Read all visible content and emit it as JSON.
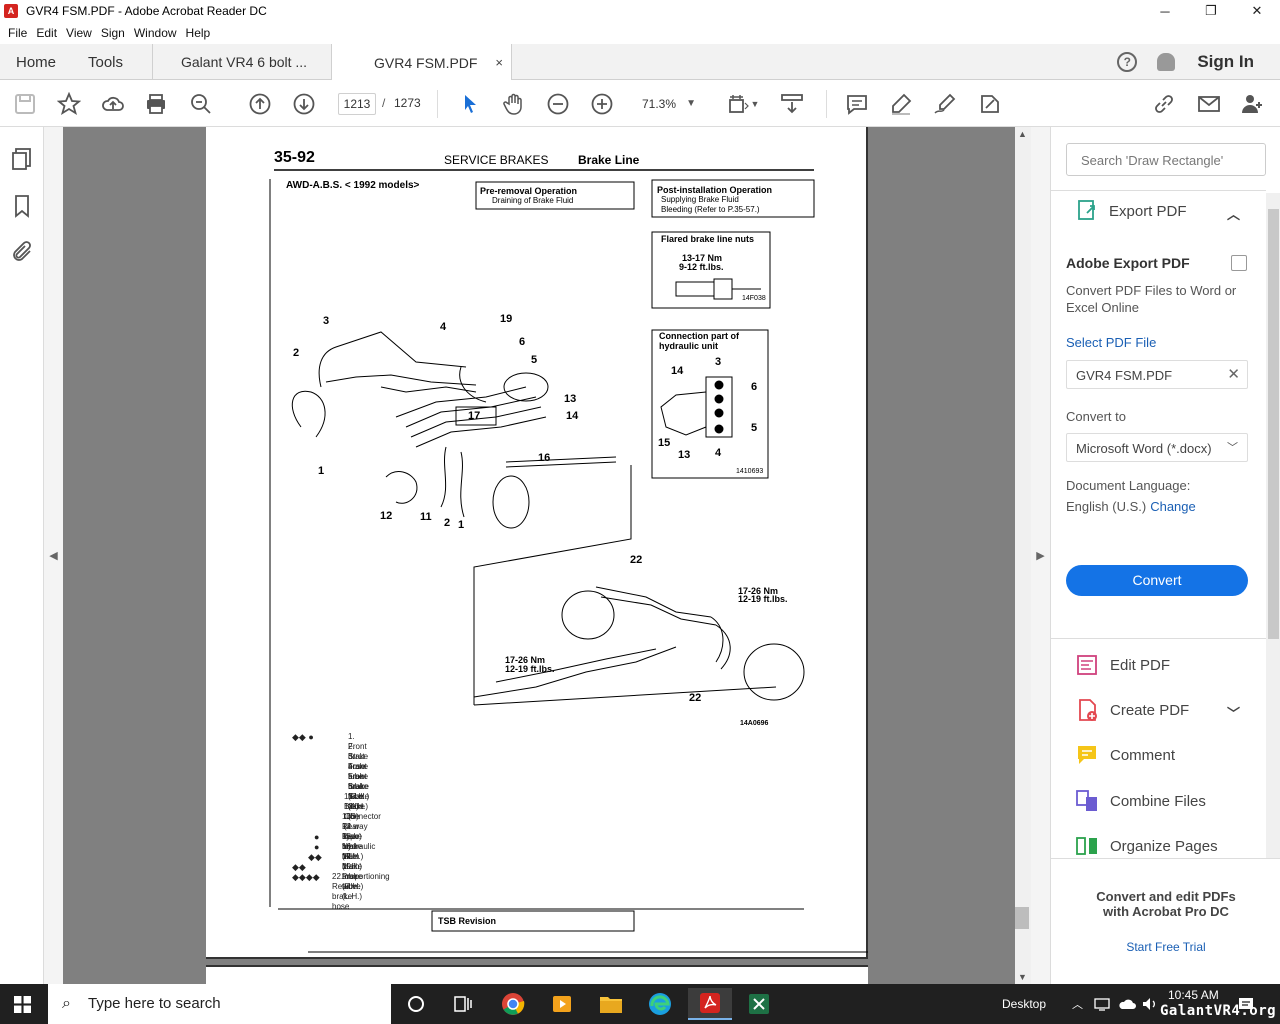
{
  "window": {
    "title": "GVR4 FSM.PDF - Adobe Acrobat Reader DC",
    "app_icon": "acrobat-icon",
    "controls": [
      "─",
      "❐",
      "✕"
    ]
  },
  "menu": [
    "File",
    "Edit",
    "View",
    "Sign",
    "Window",
    "Help"
  ],
  "tabs": {
    "home": "Home",
    "tools": "Tools",
    "doc1": "Galant VR4 6 bolt ...",
    "doc2": "GVR4 FSM.PDF",
    "close": "×"
  },
  "header_right": {
    "help": "?",
    "sign_in": "Sign In"
  },
  "toolbar": {
    "page_current": "1213",
    "page_sep": "/",
    "page_total": "1273",
    "zoom": "71.3%"
  },
  "search": {
    "placeholder": "Search 'Draw Rectangle'"
  },
  "export_panel": {
    "header": "Export PDF",
    "title": "Adobe Export PDF",
    "description": "Convert PDF Files to Word or Excel Online",
    "select_label": "Select PDF File",
    "file_name": "GVR4 FSM.PDF",
    "convert_to_label": "Convert to",
    "convert_to_value": "Microsoft Word (*.docx)",
    "doc_lang_label": "Document Language:",
    "doc_lang_value": "English (U.S.)",
    "doc_lang_change": "Change",
    "convert_button": "Convert"
  },
  "tools_list": [
    {
      "label": "Edit PDF",
      "icon": "edit-pdf-icon"
    },
    {
      "label": "Create PDF",
      "icon": "create-pdf-icon"
    },
    {
      "label": "Comment",
      "icon": "comment-icon"
    },
    {
      "label": "Combine Files",
      "icon": "combine-files-icon"
    },
    {
      "label": "Organize Pages",
      "icon": "organize-pages-icon"
    }
  ],
  "promo": {
    "line1": "Convert and edit PDFs",
    "line2": "with Acrobat Pro DC",
    "link": "Start Free Trial"
  },
  "taskbar": {
    "search_placeholder": "Type here to search",
    "desktop": "Desktop",
    "time": "10:45 AM",
    "watermark": "GalantVR4.org"
  },
  "pdf_page": {
    "page_num": "35-92",
    "heading": "SERVICE  BRAKES",
    "heading_sub": "Brake Line",
    "model_note": "AWD-A.B.S. < 1992 models>",
    "pre_removal_title": "Pre-removal  Operation",
    "pre_removal_item": "Draining of Brake Fluid",
    "post_install_title": "Post-installation  Operation",
    "post_install_item1": "Supplying  Brake  Fluid",
    "post_install_item2": "Bleeding (Refer to P.35-57.)",
    "flare_title": "Flared  brake  line  nuts",
    "flare_torque1": "13-17  Nm",
    "flare_torque2": "9-12  ft.lbs.",
    "flare_code": "14F038",
    "conn_title1": "Connection  part  of",
    "conn_title2": "hydraulic  unit",
    "conn_code": "1410693",
    "rear_torque1a": "17-26  Nm",
    "rear_torque1b": "12-19  ft.lbs.",
    "rear_torque2a": "17-26  Nm",
    "rear_torque2b": "12-19  ft.lbs.",
    "rear_code": "14A0696",
    "callouts_front": [
      "3",
      "4",
      "19",
      "2",
      "6",
      "5",
      "13",
      "17",
      "14",
      "16",
      "1",
      "12",
      "11",
      "2",
      "1"
    ],
    "callouts_conn": [
      "3",
      "14",
      "6",
      "5",
      "15",
      "13",
      "4"
    ],
    "callouts_rear": [
      "22",
      "22"
    ],
    "parts": [
      "1.  Front  brake  hose",
      "2.  Strut brake  tube",
      "3.  Front brake tube (R.H.)",
      "4.  Front  brake tube (L.H.)",
      "5.  Brake tube (A)",
      "6.  Brake tube (B)",
      "11.  Brake  tube",
      "12.  Connector  (2  way  type)",
      "13.  Rear brake tube (R.H.)",
      "14.  Rear brake tube (L.H.)",
      "15.  Hydraulic  unit",
      "16.  Main brake tube (R.H.)",
      "17.  Main brake tube (L.H.)",
      "19.  Proportioning  valve",
      "22.  Rear brake hose"
    ],
    "footer_label": "TSB  Revision"
  }
}
